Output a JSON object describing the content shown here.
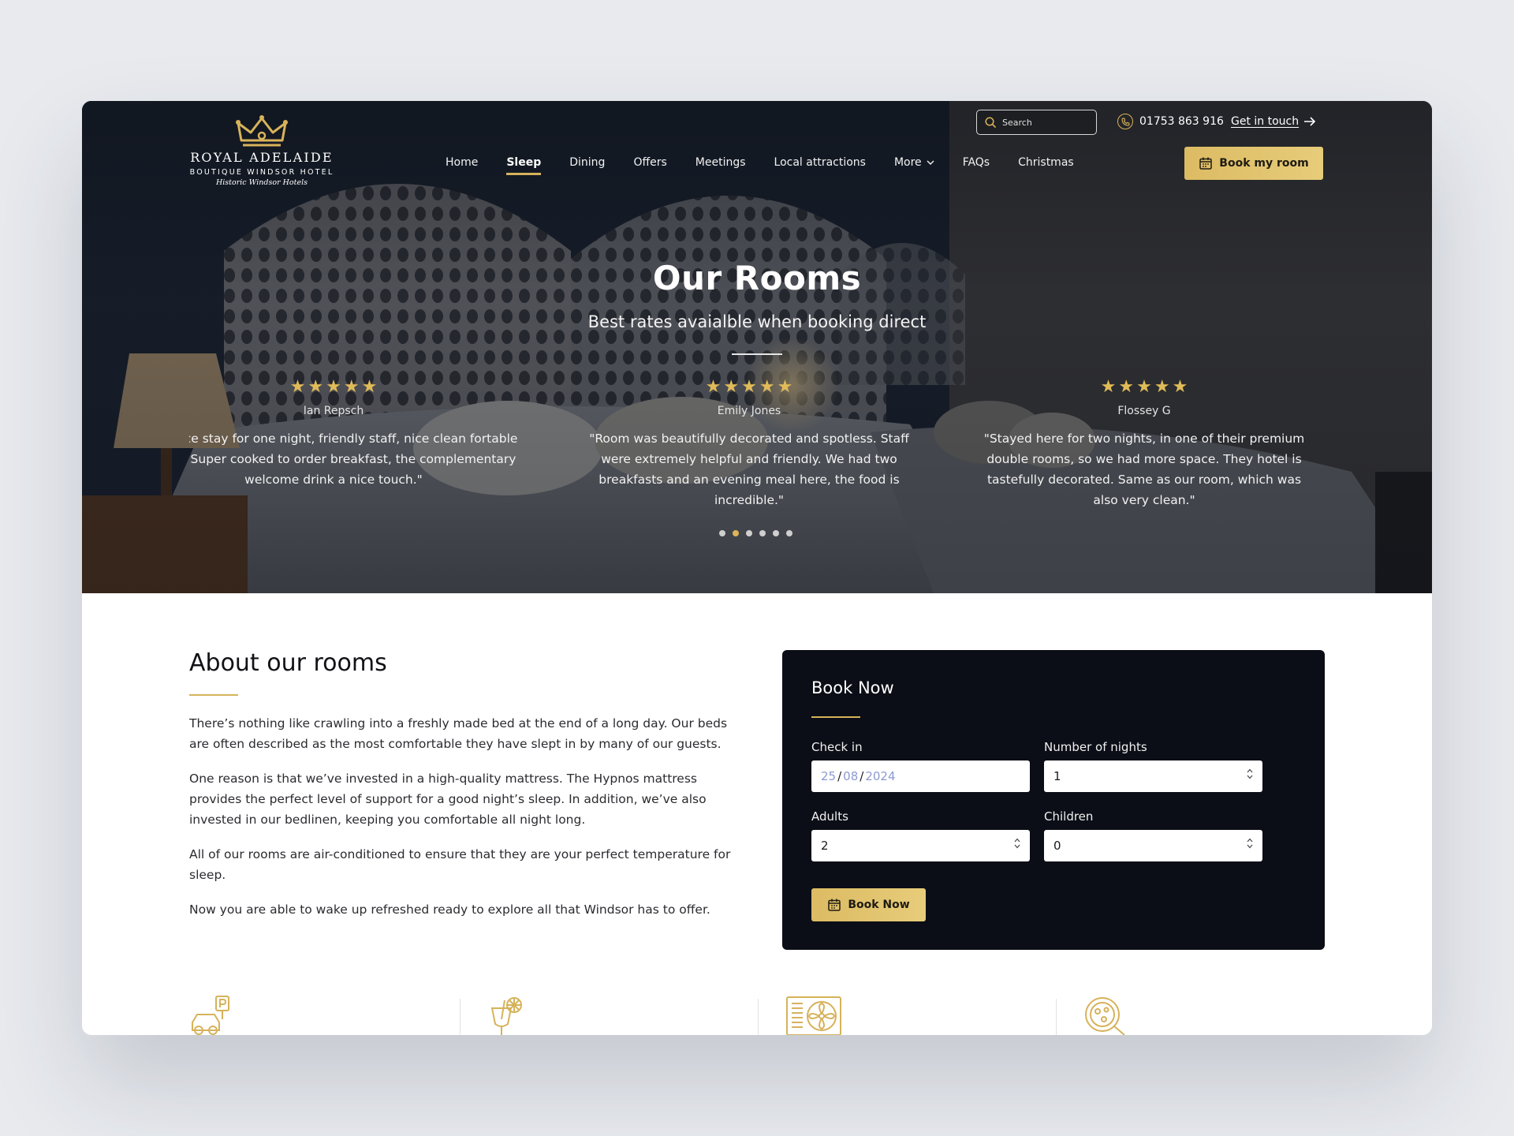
{
  "brand": {
    "name": "ROYAL ADELAIDE",
    "tagline": "BOUTIQUE WINDSOR HOTEL",
    "group": "Historic Windsor Hotels"
  },
  "header": {
    "search_placeholder": "Search",
    "phone": "01753 863 916",
    "get_in_touch": "Get in touch",
    "book_button": "Book my room"
  },
  "nav": {
    "items": [
      {
        "label": "Home"
      },
      {
        "label": "Sleep"
      },
      {
        "label": "Dining"
      },
      {
        "label": "Offers"
      },
      {
        "label": "Meetings"
      },
      {
        "label": "Local attractions"
      },
      {
        "label": "More"
      },
      {
        "label": "FAQs"
      },
      {
        "label": "Christmas"
      }
    ],
    "active": "Sleep"
  },
  "hero": {
    "title": "Our Rooms",
    "subtitle": "Best rates avaialble when booking direct"
  },
  "reviews": [
    {
      "name": "Ian Repsch",
      "rating": 5,
      "text": "ery nice stay for one night, friendly staff, nice clean fortable room. Super cooked to order breakfast, the complementary welcome drink a nice touch.\""
    },
    {
      "name": "Emily Jones",
      "rating": 5,
      "text": "\"Room was beautifully decorated and spotless. Staff were extremely helpful and friendly. We had two breakfasts and an evening meal here, the food is incredible.\""
    },
    {
      "name": "Flossey G",
      "rating": 5,
      "text": "\"Stayed here for two nights, in one of their premium double rooms, so we had more space. They hotel is tastefully decorated. Same as our room, which was also very clean.\""
    }
  ],
  "carousel": {
    "count": 6,
    "active_index": 1
  },
  "about": {
    "title": "About our rooms",
    "paragraphs": [
      "There’s nothing like crawling into a freshly made bed at the end of a long day. Our beds are often described as the most comfortable they have slept in by many of our guests.",
      "One reason is that we’ve invested in a high-quality mattress. The Hypnos mattress provides the perfect level of support for a good night’s sleep. In addition, we’ve also invested in our bedlinen, keeping you comfortable all night long.",
      "All of our rooms are air-conditioned to ensure that they are your perfect temperature for sleep.",
      "Now you are able to wake up refreshed ready to explore all that Windsor has to offer."
    ]
  },
  "booking": {
    "title": "Book Now",
    "checkin_label": "Check in",
    "checkin_day": "25",
    "checkin_month": "08",
    "checkin_year": "2024",
    "nights_label": "Number of nights",
    "nights_value": "1",
    "adults_label": "Adults",
    "adults_value": "2",
    "children_label": "Children",
    "children_value": "0",
    "submit_label": "Book Now"
  },
  "amenities": [
    "parking-icon",
    "cocktail-icon",
    "air-conditioning-icon",
    "pizza-icon"
  ],
  "colors": {
    "gold": "#d6b25a",
    "dark": "#0b0e16",
    "page_bg": "#e8eaee"
  }
}
